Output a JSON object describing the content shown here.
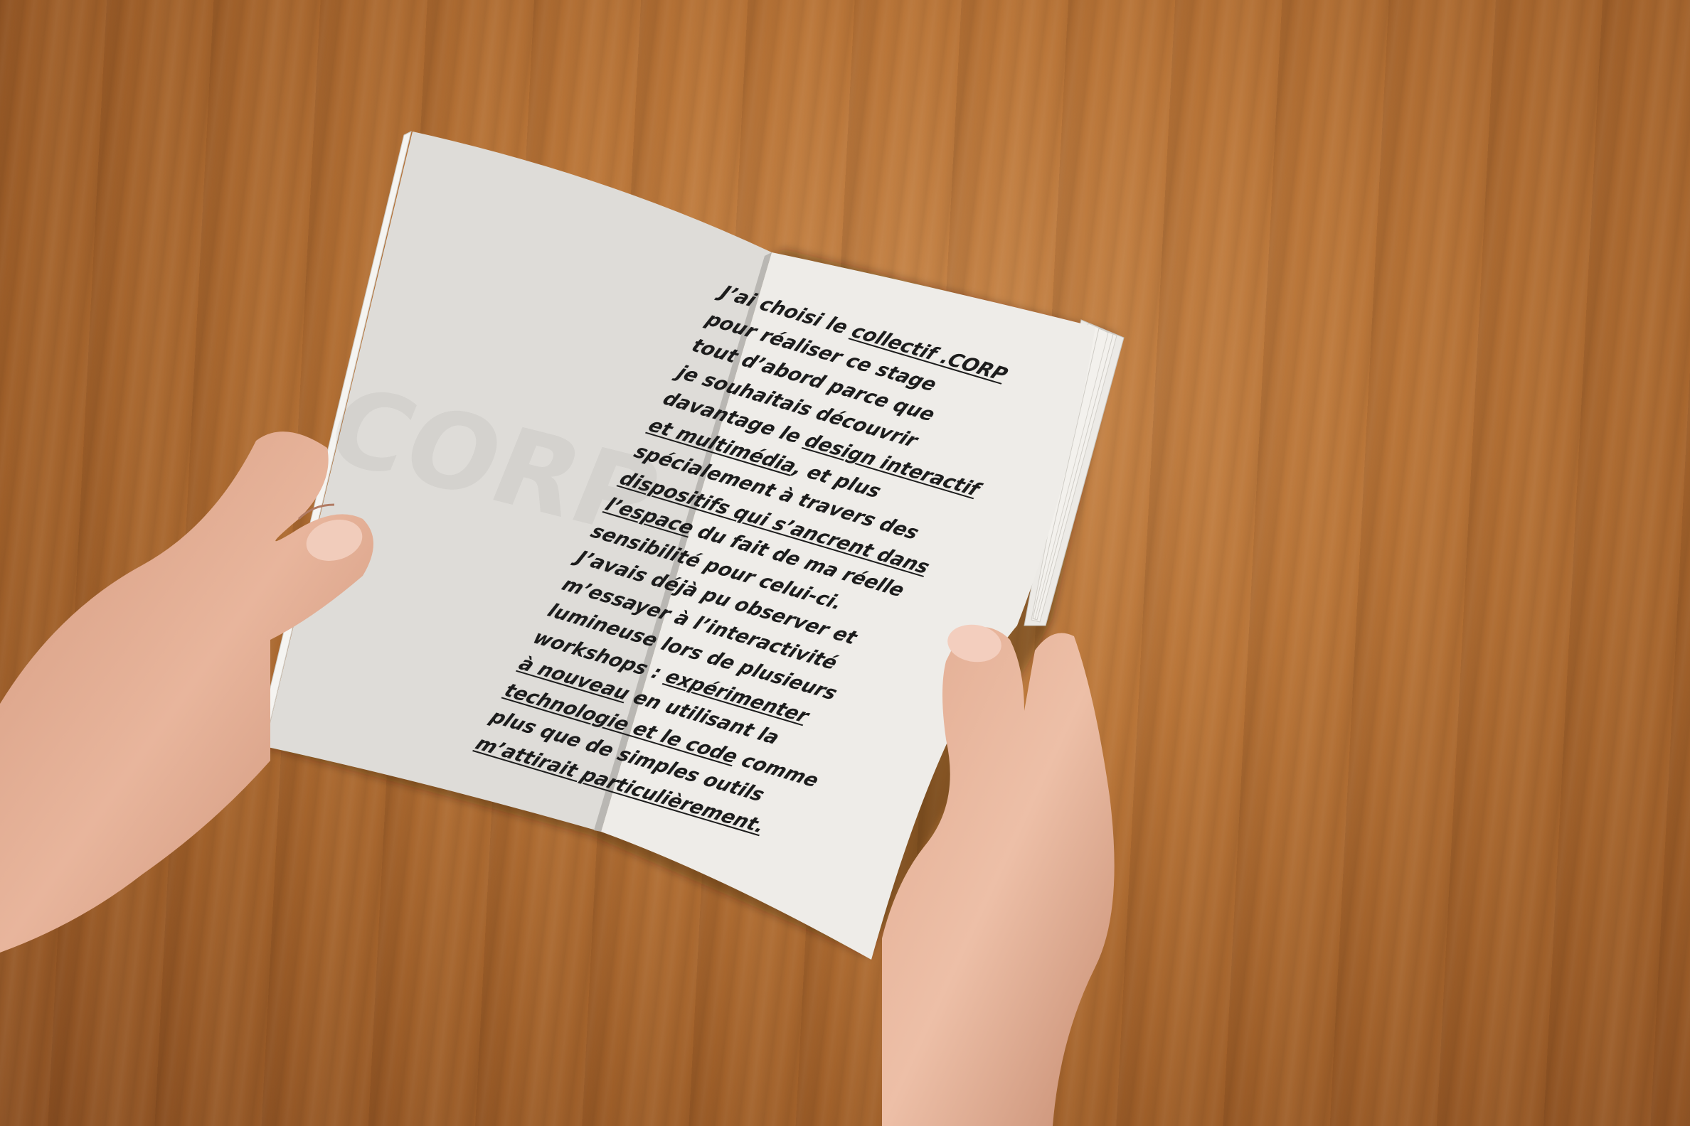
{
  "colors": {
    "table": "#b87437",
    "page_left": "#dedcd8",
    "page_right": "#eeece8",
    "text": "#1c1c1c",
    "skin": "#e9b9a1"
  },
  "book": {
    "lines": [
      [
        "J’ai choisi le ",
        "collectif .CORP",
        ""
      ],
      [
        "pour réaliser ce stage",
        "",
        ""
      ],
      [
        "tout d’abord parce que",
        "",
        ""
      ],
      [
        "je souhaitais découvrir",
        "",
        ""
      ],
      [
        "davantage le ",
        "design interactif",
        ""
      ],
      [
        "",
        "et multimédia",
        ", et plus"
      ],
      [
        "spécialement à travers des",
        "",
        ""
      ],
      [
        "",
        "dispositifs qui s’ancrent dans",
        ""
      ],
      [
        "",
        "l’espace",
        " du fait de ma réelle"
      ],
      [
        "sensibilité pour celui-ci.",
        "",
        ""
      ],
      [
        "J’avais déjà pu observer et",
        "",
        ""
      ],
      [
        "m’essayer à l’interactivité",
        "",
        ""
      ],
      [
        "lumineuse lors de plusieurs",
        "",
        ""
      ],
      [
        "workshops : ",
        "expérimenter",
        ""
      ],
      [
        "",
        "à nouveau",
        " en utilisant la"
      ],
      [
        "",
        "technologie et le code",
        " comme"
      ],
      [
        "plus que de simples outils",
        "",
        ""
      ],
      [
        "",
        "m’attirait particulièrement.",
        ""
      ]
    ]
  }
}
